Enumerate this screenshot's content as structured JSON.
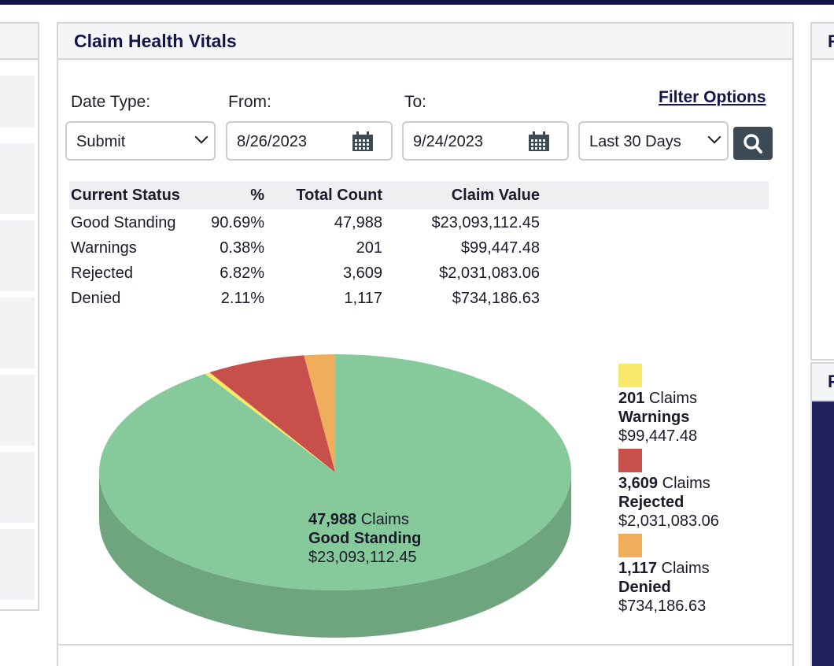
{
  "panel": {
    "title": "Claim Health Vitals",
    "filter_link": "Filter Options"
  },
  "filters": {
    "date_type_label": "Date Type:",
    "date_type_value": "Submit",
    "from_label": "From:",
    "from_value": "8/26/2023",
    "to_label": "To:",
    "to_value": "9/24/2023",
    "range_value": "Last 30 Days"
  },
  "table": {
    "headers": [
      "Current Status",
      "%",
      "Total Count",
      "Claim Value"
    ],
    "rows": [
      {
        "status": "Good Standing",
        "pct": "90.69%",
        "count": "47,988",
        "value": "$23,093,112.45"
      },
      {
        "status": "Warnings",
        "pct": "0.38%",
        "count": "201",
        "value": "$99,447.48"
      },
      {
        "status": "Rejected",
        "pct": "6.82%",
        "count": "3,609",
        "value": "$2,031,083.06"
      },
      {
        "status": "Denied",
        "pct": "2.11%",
        "count": "1,117",
        "value": "$734,186.63"
      }
    ]
  },
  "chart_data": {
    "type": "pie",
    "categories": [
      "Good Standing",
      "Warnings",
      "Rejected",
      "Denied"
    ],
    "values": [
      47988,
      201,
      3609,
      1117
    ],
    "percent": [
      90.69,
      0.38,
      6.82,
      2.11
    ],
    "claim_values": [
      "$23,093,112.45",
      "$99,447.48",
      "$2,031,083.06",
      "$734,186.63"
    ],
    "colors": [
      "#86c99a",
      "#f7e96a",
      "#c8504a",
      "#f0ad5c"
    ],
    "style": "3d",
    "legend_position": "right"
  },
  "pie_label": {
    "count": "47,988",
    "suffix": " Claims",
    "name": "Good Standing",
    "value": "$23,093,112.45"
  },
  "legend": [
    {
      "count": "201",
      "suffix": " Claims",
      "name": "Warnings",
      "value": "$99,447.48",
      "color": "#f7e96a"
    },
    {
      "count": "3,609",
      "suffix": " Claims",
      "name": "Rejected",
      "value": "$2,031,083.06",
      "color": "#c8504a"
    },
    {
      "count": "1,117",
      "suffix": " Claims",
      "name": "Denied",
      "value": "$734,186.63",
      "color": "#f0ad5c"
    }
  ],
  "side_panels": {
    "right_top_title": "R",
    "right_bottom_title": "F"
  }
}
